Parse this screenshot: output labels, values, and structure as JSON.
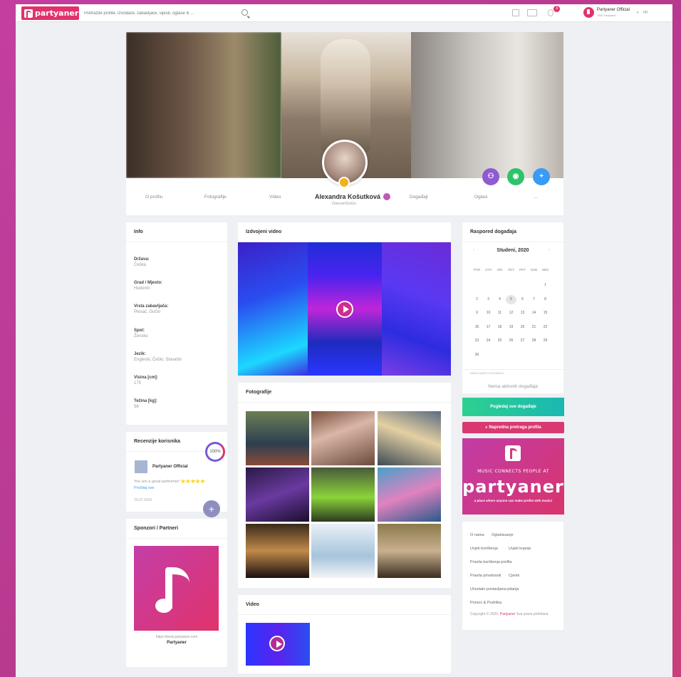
{
  "topbar": {
    "logo_text": "partyaner",
    "search_placeholder": "Pretražite profile, izvođače, zabavljače, vijesti, oglase ili ...",
    "notif_count": "3",
    "user_name": "Partyaner Official",
    "user_sub": "TMS Partyaner",
    "lang": "HR"
  },
  "profile": {
    "name": "Alexandra Košutková",
    "subtitle": "Dancer/GoGo",
    "tabs": [
      "O profilu",
      "Fotografije",
      "Video",
      "Događaji",
      "Oglasi",
      "..."
    ]
  },
  "info": {
    "title": "Info",
    "items": [
      {
        "label": "Država:",
        "value": "Češka"
      },
      {
        "label": "Grad / Mjesto:",
        "value": "Hodonín"
      },
      {
        "label": "Vrsta zabavljača:",
        "value": "Plesač, GoGo"
      },
      {
        "label": "Spol:",
        "value": "Žensko"
      },
      {
        "label": "Jezik:",
        "value": "Engleski, Češki, Slovački"
      },
      {
        "label": "Visina [cm]:",
        "value": "175"
      },
      {
        "label": "Težina [kg]:",
        "value": "56"
      }
    ]
  },
  "reviews": {
    "title": "Recenzije korisnika",
    "percent": "100%",
    "reviewer": "Partyaner Official",
    "text": "You are a great performer! ⭐⭐⭐⭐⭐",
    "link": "Pročitaj sve",
    "date": "23.07.2020."
  },
  "sponsors": {
    "title": "Sponzori / Partneri",
    "url": "https://www.partyaner.com",
    "name": "Partyaner"
  },
  "featured_video": {
    "title": "Izdvojeni video"
  },
  "photos": {
    "title": "Fotografije"
  },
  "video": {
    "title": "Video"
  },
  "calendar": {
    "title": "Raspored događaja",
    "month": "Studeni, 2020",
    "weekdays": [
      "PON",
      "UTO",
      "SRI",
      "ČET",
      "PET",
      "SUB",
      "NED"
    ],
    "days": [
      "1",
      "2",
      "3",
      "4",
      "5",
      "6",
      "7",
      "8",
      "9",
      "10",
      "11",
      "12",
      "13",
      "14",
      "15",
      "16",
      "17",
      "18",
      "19",
      "20",
      "21",
      "22",
      "23",
      "24",
      "25",
      "26",
      "27",
      "28",
      "29",
      "30"
    ],
    "selected": "5",
    "upcoming_label": "NADOLAZEĆI DOGAĐAJI",
    "no_events": "Nema aktivnih događaja",
    "btn_all": "Pogledaj sve događaje",
    "btn_search": "Napredna pretraga profila"
  },
  "ad": {
    "line1": "MUSIC CONNECTS PEOPLE AT",
    "brand": "partyaner",
    "line3": "a place where anyone can make profits with music!"
  },
  "footer": {
    "links": [
      "O nama",
      "Oglašavanje",
      "Uvjeti korištenja",
      "Uvjeti kupnje",
      "Pravila korištenja profila",
      "Pravila privatnosti",
      "Cjenik",
      "Učestalo postavljana pitanja",
      "Pomoć & Podrška"
    ],
    "copyright_prefix": "Copyright © 2020.",
    "copyright_brand": "Partyaner",
    "copyright_suffix": "Sva prava pridržana"
  },
  "colors": {
    "brand": "#e0336b",
    "accent_purple": "#8e5bd0",
    "accent_green": "#2ec36a",
    "accent_blue": "#3a9af5"
  }
}
